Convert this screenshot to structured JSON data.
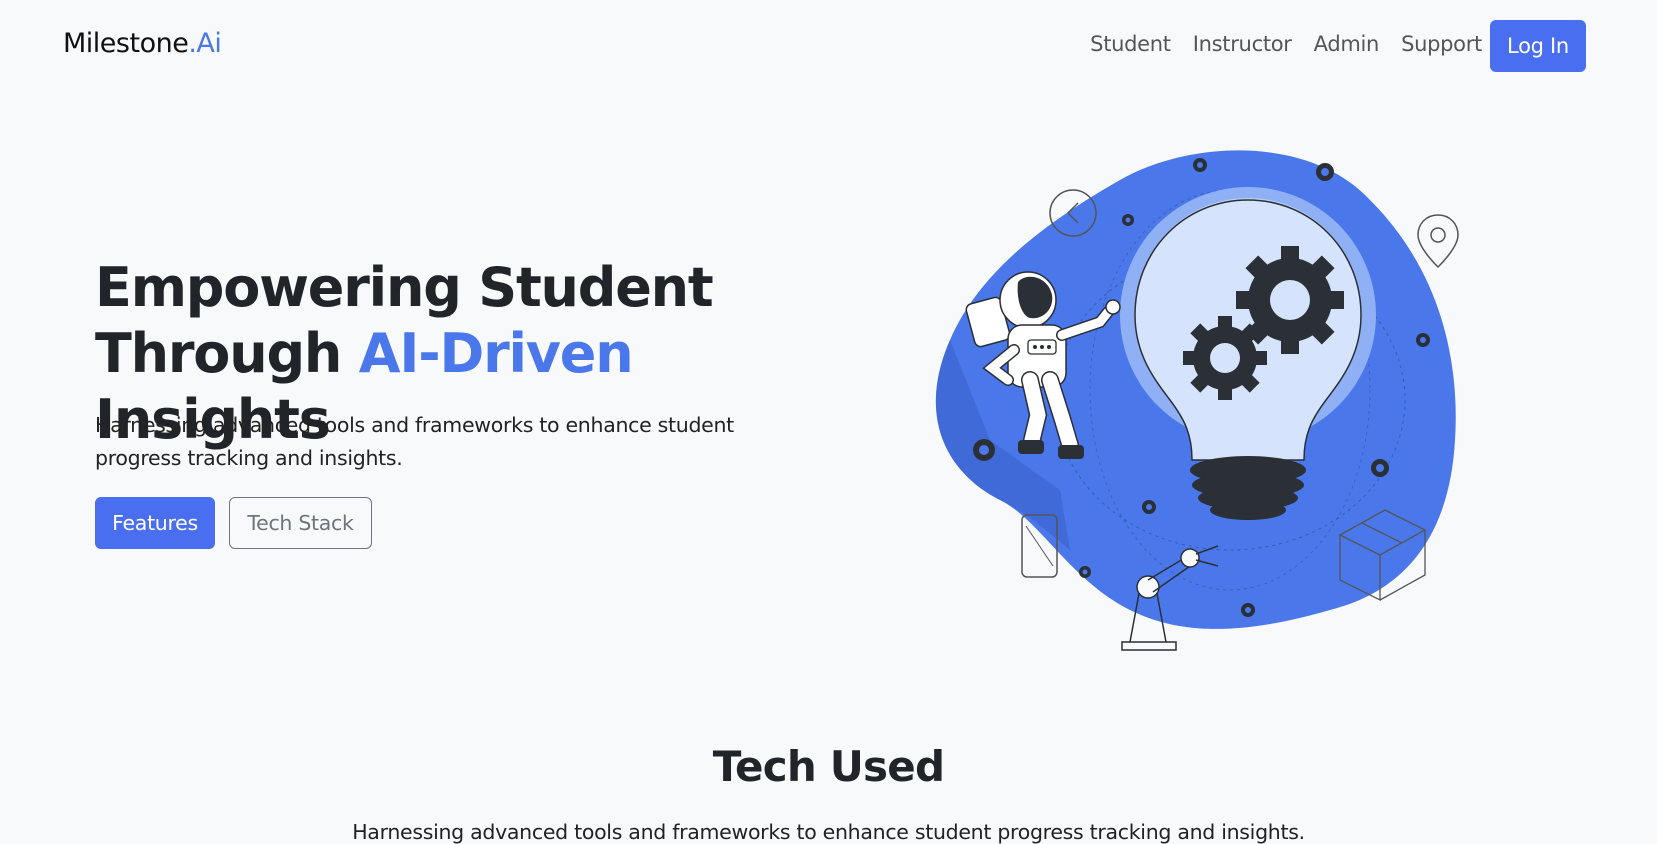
{
  "navbar": {
    "brand_main": "Milestone",
    "brand_accent": ".Ai",
    "links": [
      {
        "label": "Student"
      },
      {
        "label": "Instructor"
      },
      {
        "label": "Admin"
      },
      {
        "label": "Support"
      }
    ],
    "login_label": "Log In"
  },
  "hero": {
    "title_line1": "Empowering Student",
    "title_line2_start": "Through ",
    "title_line2_accent": "AI-Driven",
    "title_line2_end": " Insights",
    "subtitle": "Harnessing advanced tools and frameworks to enhance student progress tracking and insights.",
    "primary_button": "Features",
    "secondary_button": "Tech Stack"
  },
  "tech_section": {
    "title": "Tech Used",
    "subtitle": "Harnessing advanced tools and frameworks to enhance student progress tracking and insights."
  },
  "colors": {
    "accent": "#4a77ea",
    "button_primary": "#4a6ef0",
    "background": "#f8f9fa",
    "blob": "#4a77ea"
  },
  "icons": {
    "illustration": "lightbulb-gears-astronaut-illustration"
  }
}
